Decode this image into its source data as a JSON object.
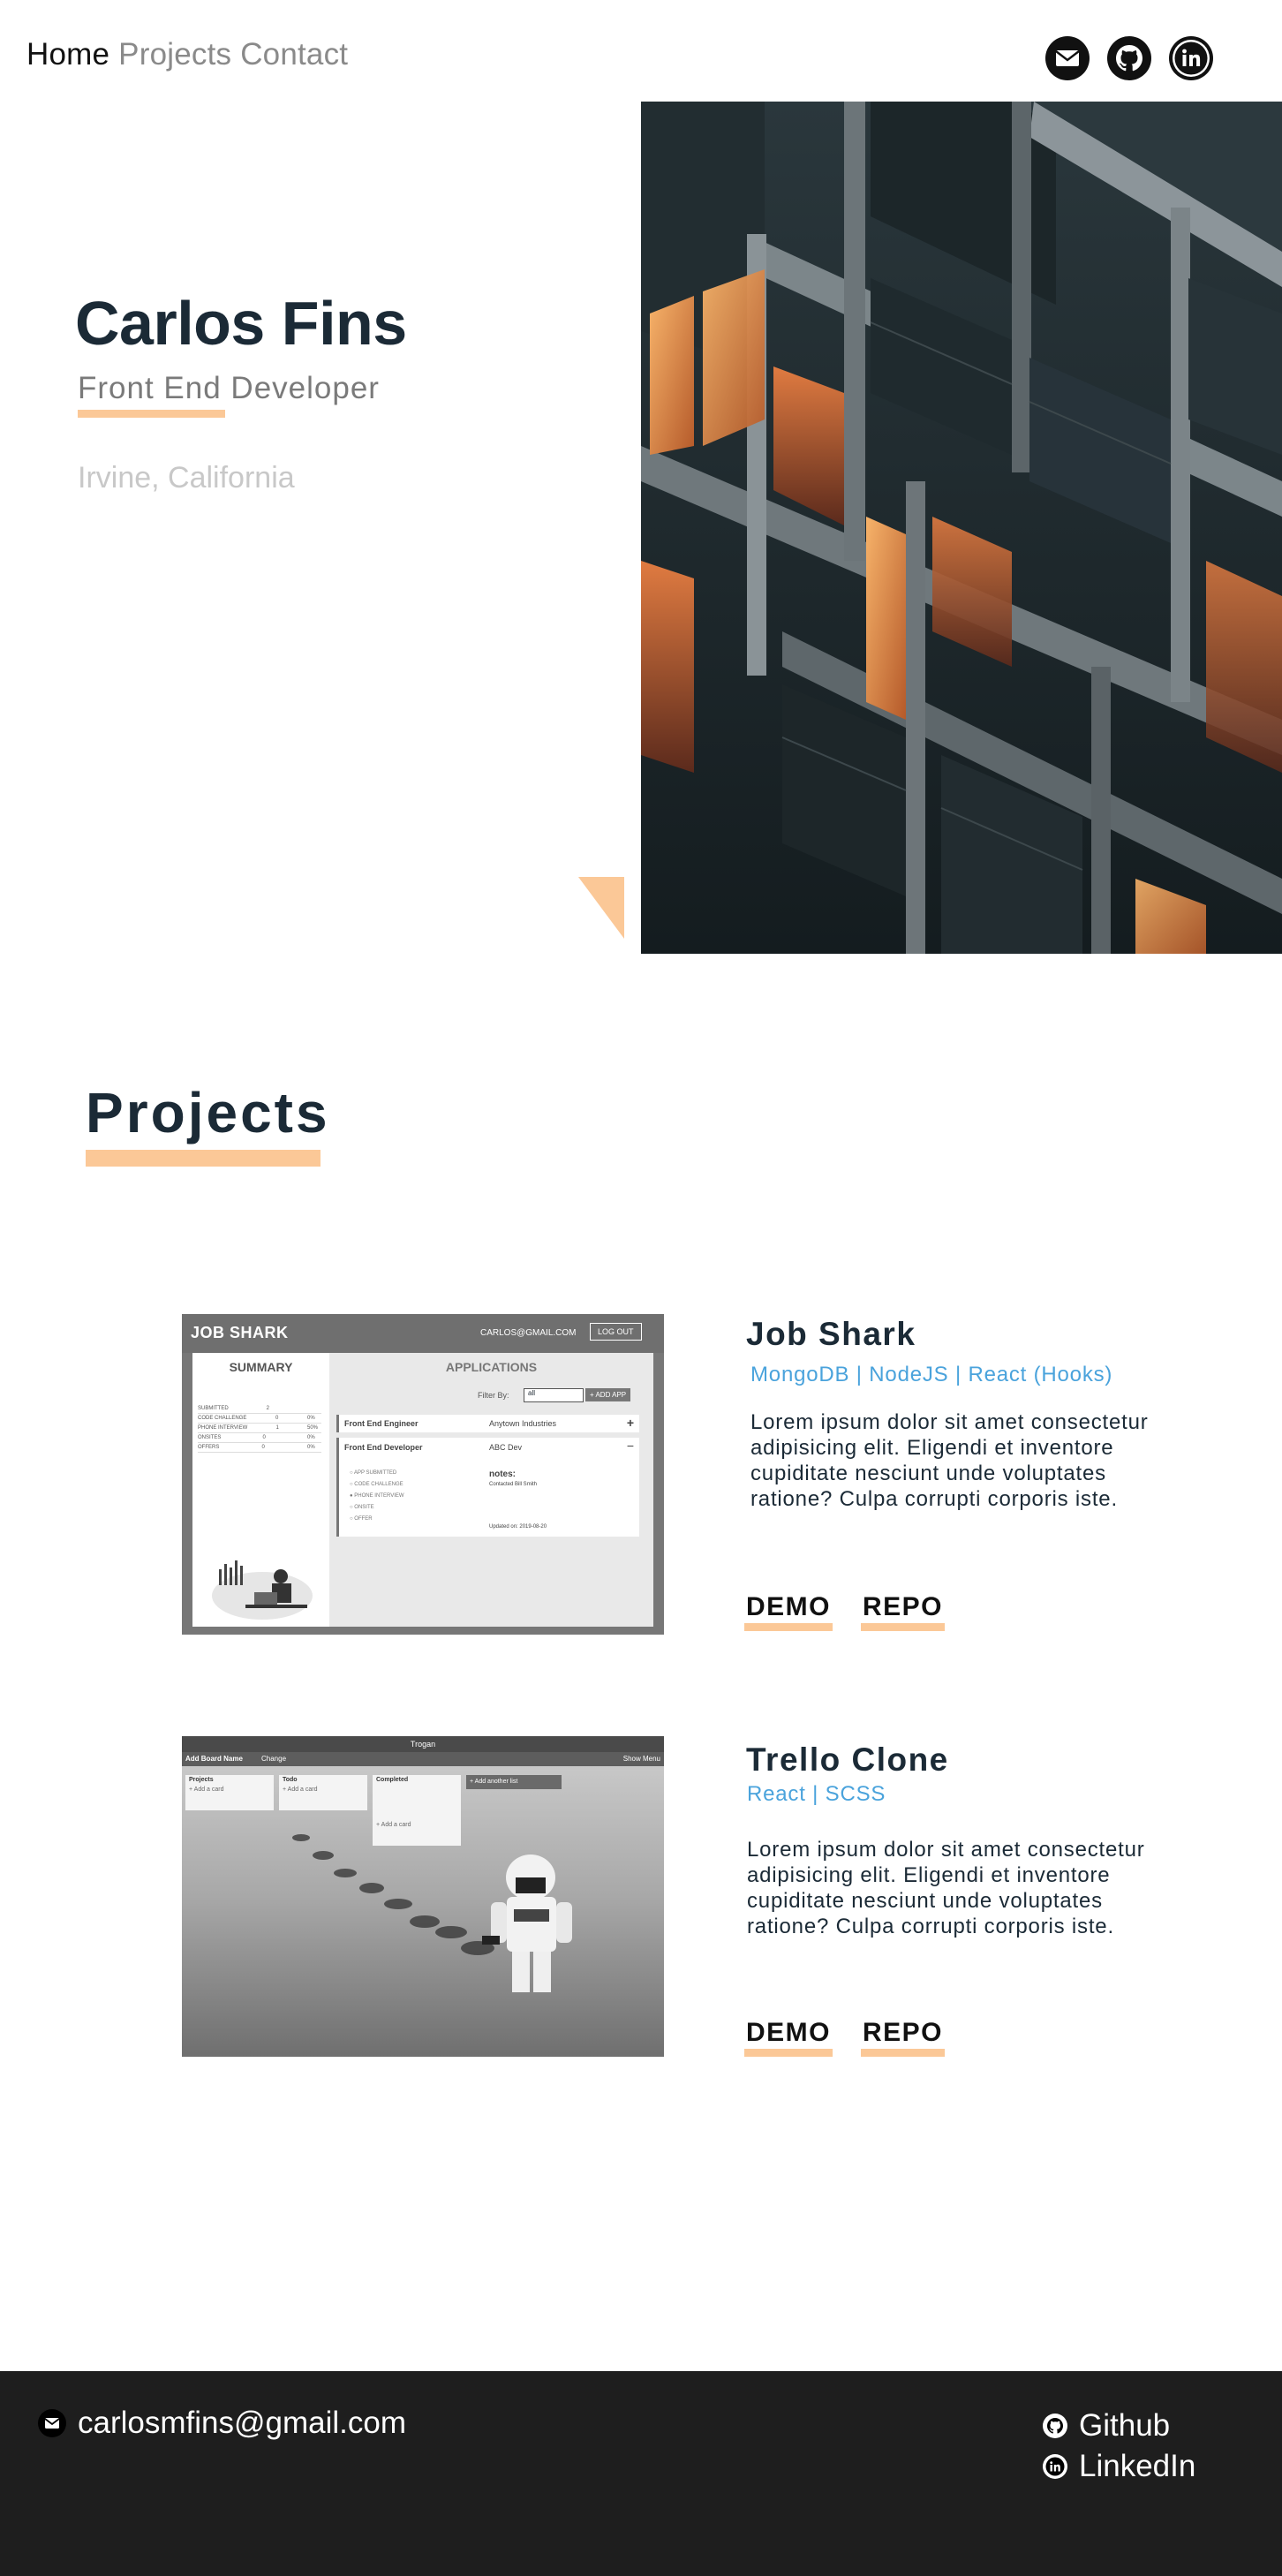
{
  "nav": {
    "home": "Home",
    "projects": "Projects",
    "contact": "Contact"
  },
  "social_icons": [
    "email-icon",
    "github-icon",
    "linkedin-icon"
  ],
  "hero": {
    "name": "Carlos Fins",
    "role": "Front End Developer",
    "location": "Irvine, California"
  },
  "projects": {
    "heading": "Projects",
    "items": [
      {
        "title": "Job Shark",
        "tech": "MongoDB | NodeJS | React (Hooks)",
        "desc": "Lorem ipsum dolor sit amet consectetur adipisicing elit. Eligendi et inventore cupiditate nesciunt unde voluptates ratione? Culpa corrupti corporis iste.",
        "demo": "DEMO",
        "repo": "REPO",
        "shot": {
          "brand": "JOB SHARK",
          "user": "CARLOS@GMAIL.COM",
          "logout": "LOG OUT",
          "summary": "SUMMARY",
          "applications": "APPLICATIONS",
          "filter_label": "Filter By:",
          "filter_value": "all",
          "add_app": "+ ADD APP",
          "stats": [
            {
              "label": "SUBMITTED",
              "a": "2",
              "b": ""
            },
            {
              "label": "CODE CHALLENGE",
              "a": "0",
              "b": "0%"
            },
            {
              "label": "PHONE INTERVIEW",
              "a": "1",
              "b": "50%"
            },
            {
              "label": "ONSITES",
              "a": "0",
              "b": "0%"
            },
            {
              "label": "OFFERS",
              "a": "0",
              "b": "0%"
            }
          ],
          "app1": {
            "role": "Front End Engineer",
            "company": "Anytown Industries"
          },
          "app2": {
            "role": "Front End Developer",
            "company": "ABC Dev"
          },
          "statuses": [
            "APP SUBMITTED",
            "CODE CHALLENGE",
            "PHONE INTERVIEW",
            "ONSITE",
            "OFFER"
          ],
          "notes_label": "notes:",
          "notes_text": "Contacted Bill Smith",
          "updated": "Updated on: 2019-08-20"
        }
      },
      {
        "title": "Trello Clone",
        "tech": "React | SCSS",
        "desc": "Lorem ipsum dolor sit amet consectetur adipisicing elit. Eligendi et inventore cupiditate nesciunt unde voluptates ratione? Culpa corrupti corporis iste.",
        "demo": "DEMO",
        "repo": "REPO",
        "shot": {
          "app_name": "Trogan",
          "add_board": "Add Board Name",
          "board_label": "Change",
          "show_menu": "Show Menu",
          "lists": [
            "Projects",
            "Todo",
            "Completed"
          ],
          "add_list": "+ Add another list",
          "card_add": "+ Add a card"
        }
      }
    ]
  },
  "footer": {
    "email": "carlosmfins@gmail.com",
    "github": "Github",
    "linkedin": "LinkedIn"
  },
  "colors": {
    "accent": "#fbc897",
    "link_blue": "#4aa3dc",
    "dark": "#1b2a36",
    "footer_bg": "#1e1e1e"
  }
}
